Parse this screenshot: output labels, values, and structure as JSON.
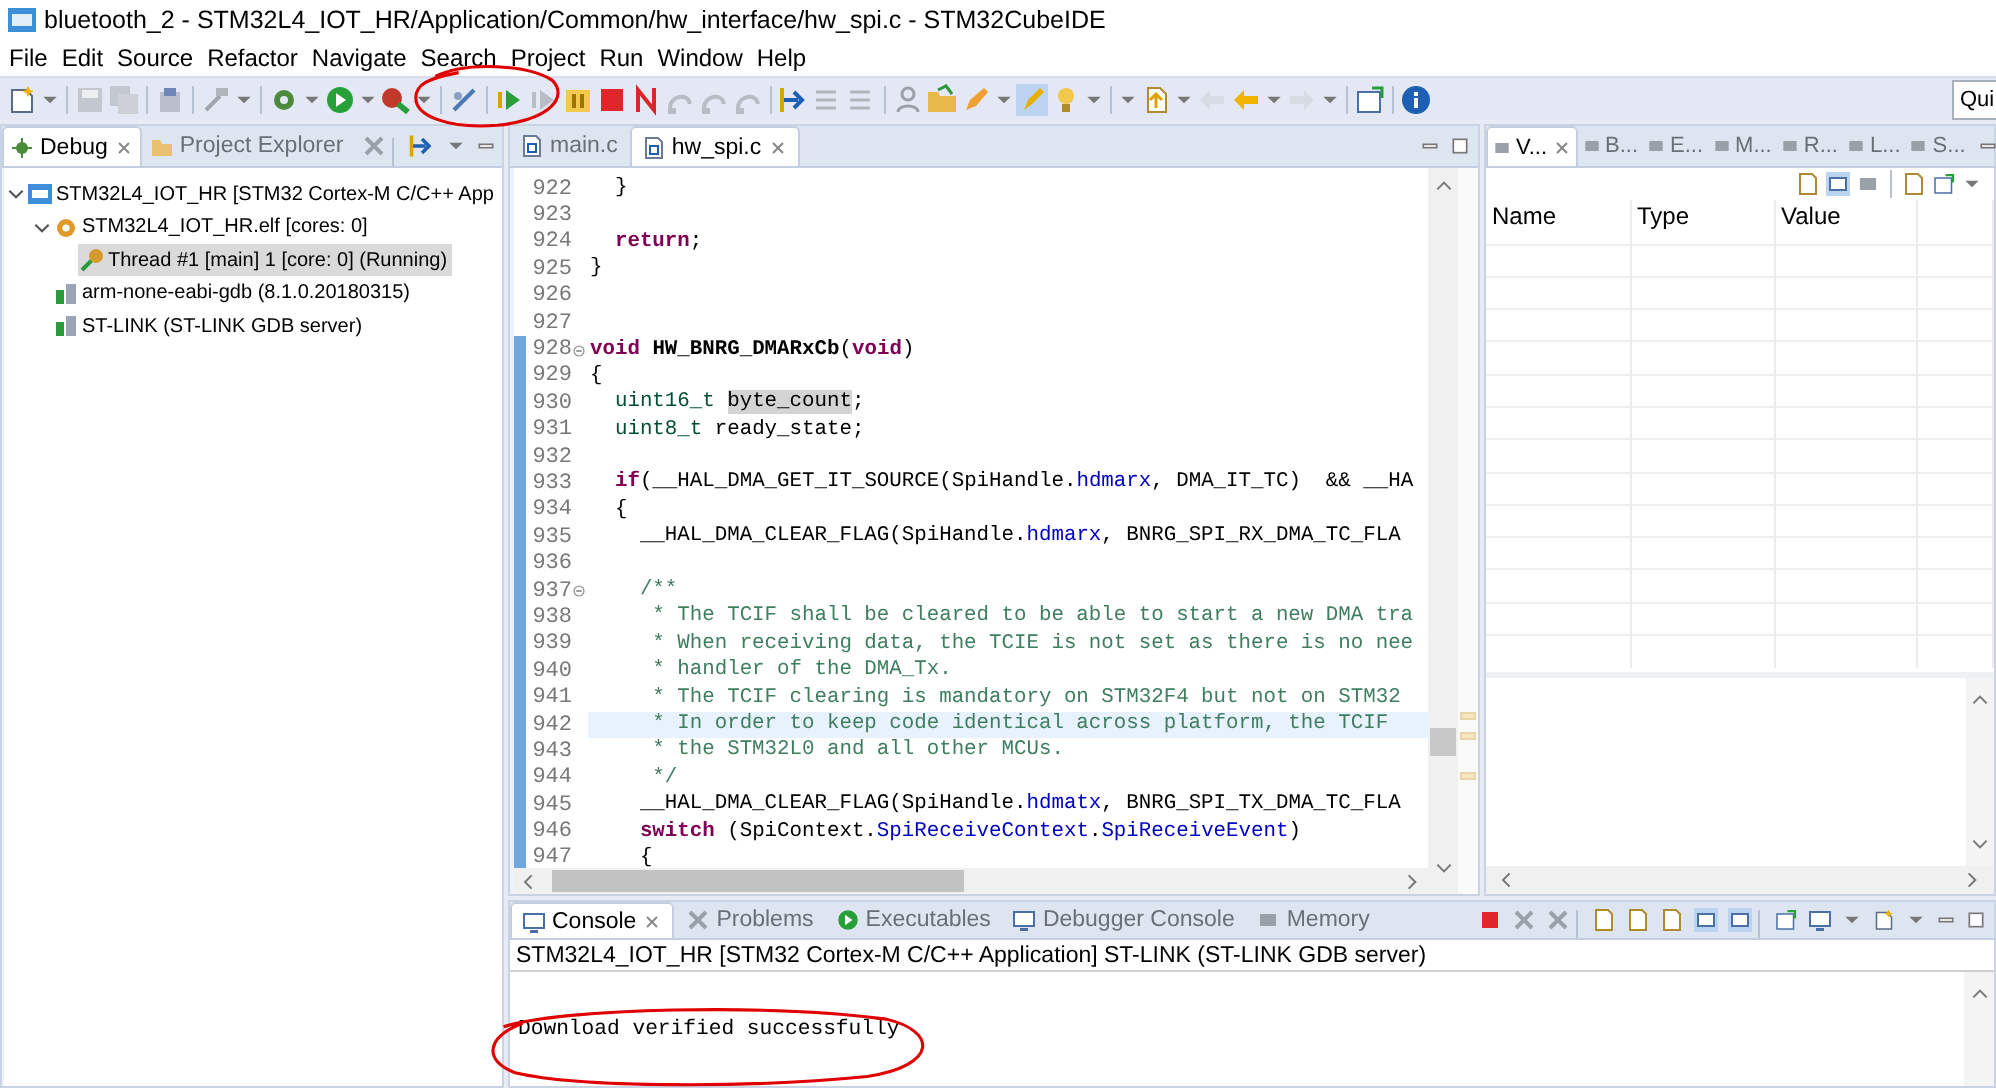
{
  "window": {
    "title": "bluetooth_2 - STM32L4_IOT_HR/Application/Common/hw_interface/hw_spi.c - STM32CubeIDE"
  },
  "menu": [
    "File",
    "Edit",
    "Source",
    "Refactor",
    "Navigate",
    "Search",
    "Project",
    "Run",
    "Window",
    "Help"
  ],
  "quick_access": {
    "placeholder": "Qui"
  },
  "debug_view": {
    "tabs": [
      {
        "label": "Debug",
        "selected": true
      },
      {
        "label": "Project Explorer",
        "selected": false
      }
    ],
    "tree": [
      {
        "label": "STM32L4_IOT_HR [STM32 Cortex-M C/C++ App",
        "kind": "launch",
        "selected": false,
        "expanded": true,
        "children": [
          {
            "label": "STM32L4_IOT_HR.elf [cores: 0]",
            "kind": "elf",
            "selected": false,
            "expanded": true,
            "children": [
              {
                "label": "Thread #1 [main] 1 [core: 0] (Running)",
                "kind": "thread",
                "selected": true
              }
            ]
          },
          {
            "label": "arm-none-eabi-gdb (8.1.0.20180315)",
            "kind": "process",
            "selected": false
          },
          {
            "label": "ST-LINK (ST-LINK GDB server)",
            "kind": "process",
            "selected": false
          }
        ]
      }
    ]
  },
  "editor": {
    "tabs": [
      {
        "label": "main.c",
        "selected": false
      },
      {
        "label": "hw_spi.c",
        "selected": true
      }
    ],
    "lines": [
      {
        "number": "922",
        "changed": false,
        "foldable": false,
        "current": false,
        "segments": [
          {
            "kind": "plain",
            "text": "  }"
          }
        ]
      },
      {
        "number": "923",
        "changed": false,
        "foldable": false,
        "current": false
      },
      {
        "number": "924",
        "changed": false,
        "foldable": false,
        "current": false,
        "segments": [
          {
            "kind": "keyword",
            "text": "  return"
          },
          {
            "kind": "plain",
            "text": ";"
          }
        ]
      },
      {
        "number": "925",
        "changed": false,
        "foldable": false,
        "current": false,
        "segments": [
          {
            "kind": "plain",
            "text": "}"
          }
        ]
      },
      {
        "number": "926",
        "changed": false,
        "foldable": false,
        "current": false
      },
      {
        "number": "927",
        "changed": false,
        "foldable": false,
        "current": false
      },
      {
        "number": "928",
        "changed": true,
        "foldable": true,
        "current": false,
        "segments": [
          {
            "kind": "keyword",
            "text": "void"
          },
          {
            "kind": "function",
            "text": " HW_BNRG_DMARxCb"
          },
          {
            "kind": "plain",
            "text": "("
          },
          {
            "kind": "keyword",
            "text": "void"
          },
          {
            "kind": "plain",
            "text": ")"
          }
        ]
      },
      {
        "number": "929",
        "changed": true,
        "foldable": false,
        "current": false,
        "segments": [
          {
            "kind": "plain",
            "text": "{"
          }
        ]
      },
      {
        "number": "930",
        "changed": true,
        "foldable": false,
        "current": false,
        "segments": [
          {
            "kind": "type",
            "text": "  uint16_t "
          },
          {
            "kind": "occurrence",
            "text": "byte_count"
          },
          {
            "kind": "plain",
            "text": ";"
          }
        ]
      },
      {
        "number": "931",
        "changed": true,
        "foldable": false,
        "current": false,
        "segments": [
          {
            "kind": "type",
            "text": "  uint8_t"
          },
          {
            "kind": "plain",
            "text": " ready_state;"
          }
        ]
      },
      {
        "number": "932",
        "changed": true,
        "foldable": false,
        "current": false
      },
      {
        "number": "933",
        "changed": true,
        "foldable": false,
        "current": false,
        "segments": [
          {
            "kind": "keyword",
            "text": "  if"
          },
          {
            "kind": "plain",
            "text": "(__HAL_DMA_GET_IT_SOURCE(SpiHandle."
          },
          {
            "kind": "field",
            "text": "hdmarx"
          },
          {
            "kind": "plain",
            "text": ", DMA_IT_TC)  && __HA"
          }
        ]
      },
      {
        "number": "934",
        "changed": true,
        "foldable": false,
        "current": false,
        "segments": [
          {
            "kind": "plain",
            "text": "  {"
          }
        ]
      },
      {
        "number": "935",
        "changed": true,
        "foldable": false,
        "current": false,
        "segments": [
          {
            "kind": "plain",
            "text": "    __HAL_DMA_CLEAR_FLAG(SpiHandle."
          },
          {
            "kind": "field",
            "text": "hdmarx"
          },
          {
            "kind": "plain",
            "text": ", BNRG_SPI_RX_DMA_TC_FLA"
          }
        ]
      },
      {
        "number": "936",
        "changed": true,
        "foldable": false,
        "current": false
      },
      {
        "number": "937",
        "changed": true,
        "foldable": true,
        "current": false,
        "segments": [
          {
            "kind": "comment",
            "text": "    /**"
          }
        ]
      },
      {
        "number": "938",
        "changed": true,
        "foldable": false,
        "current": false,
        "segments": [
          {
            "kind": "comment",
            "text": "     * The TCIF shall be cleared to be able to start a new DMA tra"
          }
        ]
      },
      {
        "number": "939",
        "changed": true,
        "foldable": false,
        "current": false,
        "segments": [
          {
            "kind": "comment",
            "text": "     * When receiving data, the TCIE is not set as there is no nee"
          }
        ]
      },
      {
        "number": "940",
        "changed": true,
        "foldable": false,
        "current": false,
        "segments": [
          {
            "kind": "comment",
            "text": "     * handler of the DMA_Tx."
          }
        ]
      },
      {
        "number": "941",
        "changed": true,
        "foldable": false,
        "current": false,
        "segments": [
          {
            "kind": "comment",
            "text": "     * The TCIF clearing is mandatory on STM32F4 but not on STM32"
          }
        ]
      },
      {
        "number": "942",
        "changed": true,
        "foldable": false,
        "current": true,
        "segments": [
          {
            "kind": "comment",
            "text": "     * In order to keep code identical across platform, the TCIF"
          }
        ]
      },
      {
        "number": "943",
        "changed": true,
        "foldable": false,
        "current": false,
        "segments": [
          {
            "kind": "comment",
            "text": "     * the STM32L0 and all other MCUs."
          }
        ]
      },
      {
        "number": "944",
        "changed": true,
        "foldable": false,
        "current": false,
        "segments": [
          {
            "kind": "comment",
            "text": "     */"
          }
        ]
      },
      {
        "number": "945",
        "changed": true,
        "foldable": false,
        "current": false,
        "segments": [
          {
            "kind": "plain",
            "text": "    __HAL_DMA_CLEAR_FLAG(SpiHandle."
          },
          {
            "kind": "field",
            "text": "hdmatx"
          },
          {
            "kind": "plain",
            "text": ", BNRG_SPI_TX_DMA_TC_FLA"
          }
        ]
      },
      {
        "number": "946",
        "changed": true,
        "foldable": false,
        "current": false,
        "segments": [
          {
            "kind": "keyword",
            "text": "    switch"
          },
          {
            "kind": "plain",
            "text": " (SpiContext."
          },
          {
            "kind": "field",
            "text": "SpiReceiveContext"
          },
          {
            "kind": "plain",
            "text": "."
          },
          {
            "kind": "field",
            "text": "SpiReceiveEvent"
          },
          {
            "kind": "plain",
            "text": ")"
          }
        ]
      },
      {
        "number": "947",
        "changed": true,
        "foldable": false,
        "current": false,
        "segments": [
          {
            "kind": "plain",
            "text": "    {"
          }
        ]
      }
    ]
  },
  "variables_view": {
    "tabs": [
      {
        "label": "V...",
        "selected": true
      },
      {
        "label": "B...",
        "selected": false
      },
      {
        "label": "E...",
        "selected": false
      },
      {
        "label": "M...",
        "selected": false
      },
      {
        "label": "R...",
        "selected": false
      },
      {
        "label": "L...",
        "selected": false
      },
      {
        "label": "S...",
        "selected": false
      }
    ],
    "columns": [
      "Name",
      "Type",
      "Value"
    ]
  },
  "console": {
    "tabs": [
      {
        "label": "Console",
        "selected": true
      },
      {
        "label": "Problems",
        "selected": false
      },
      {
        "label": "Executables",
        "selected": false
      },
      {
        "label": "Debugger Console",
        "selected": false
      },
      {
        "label": "Memory",
        "selected": false
      }
    ],
    "header": "STM32L4_IOT_HR [STM32 Cortex-M C/C++ Application] ST-LINK (ST-LINK GDB server)",
    "output": "Download verified successfully"
  }
}
